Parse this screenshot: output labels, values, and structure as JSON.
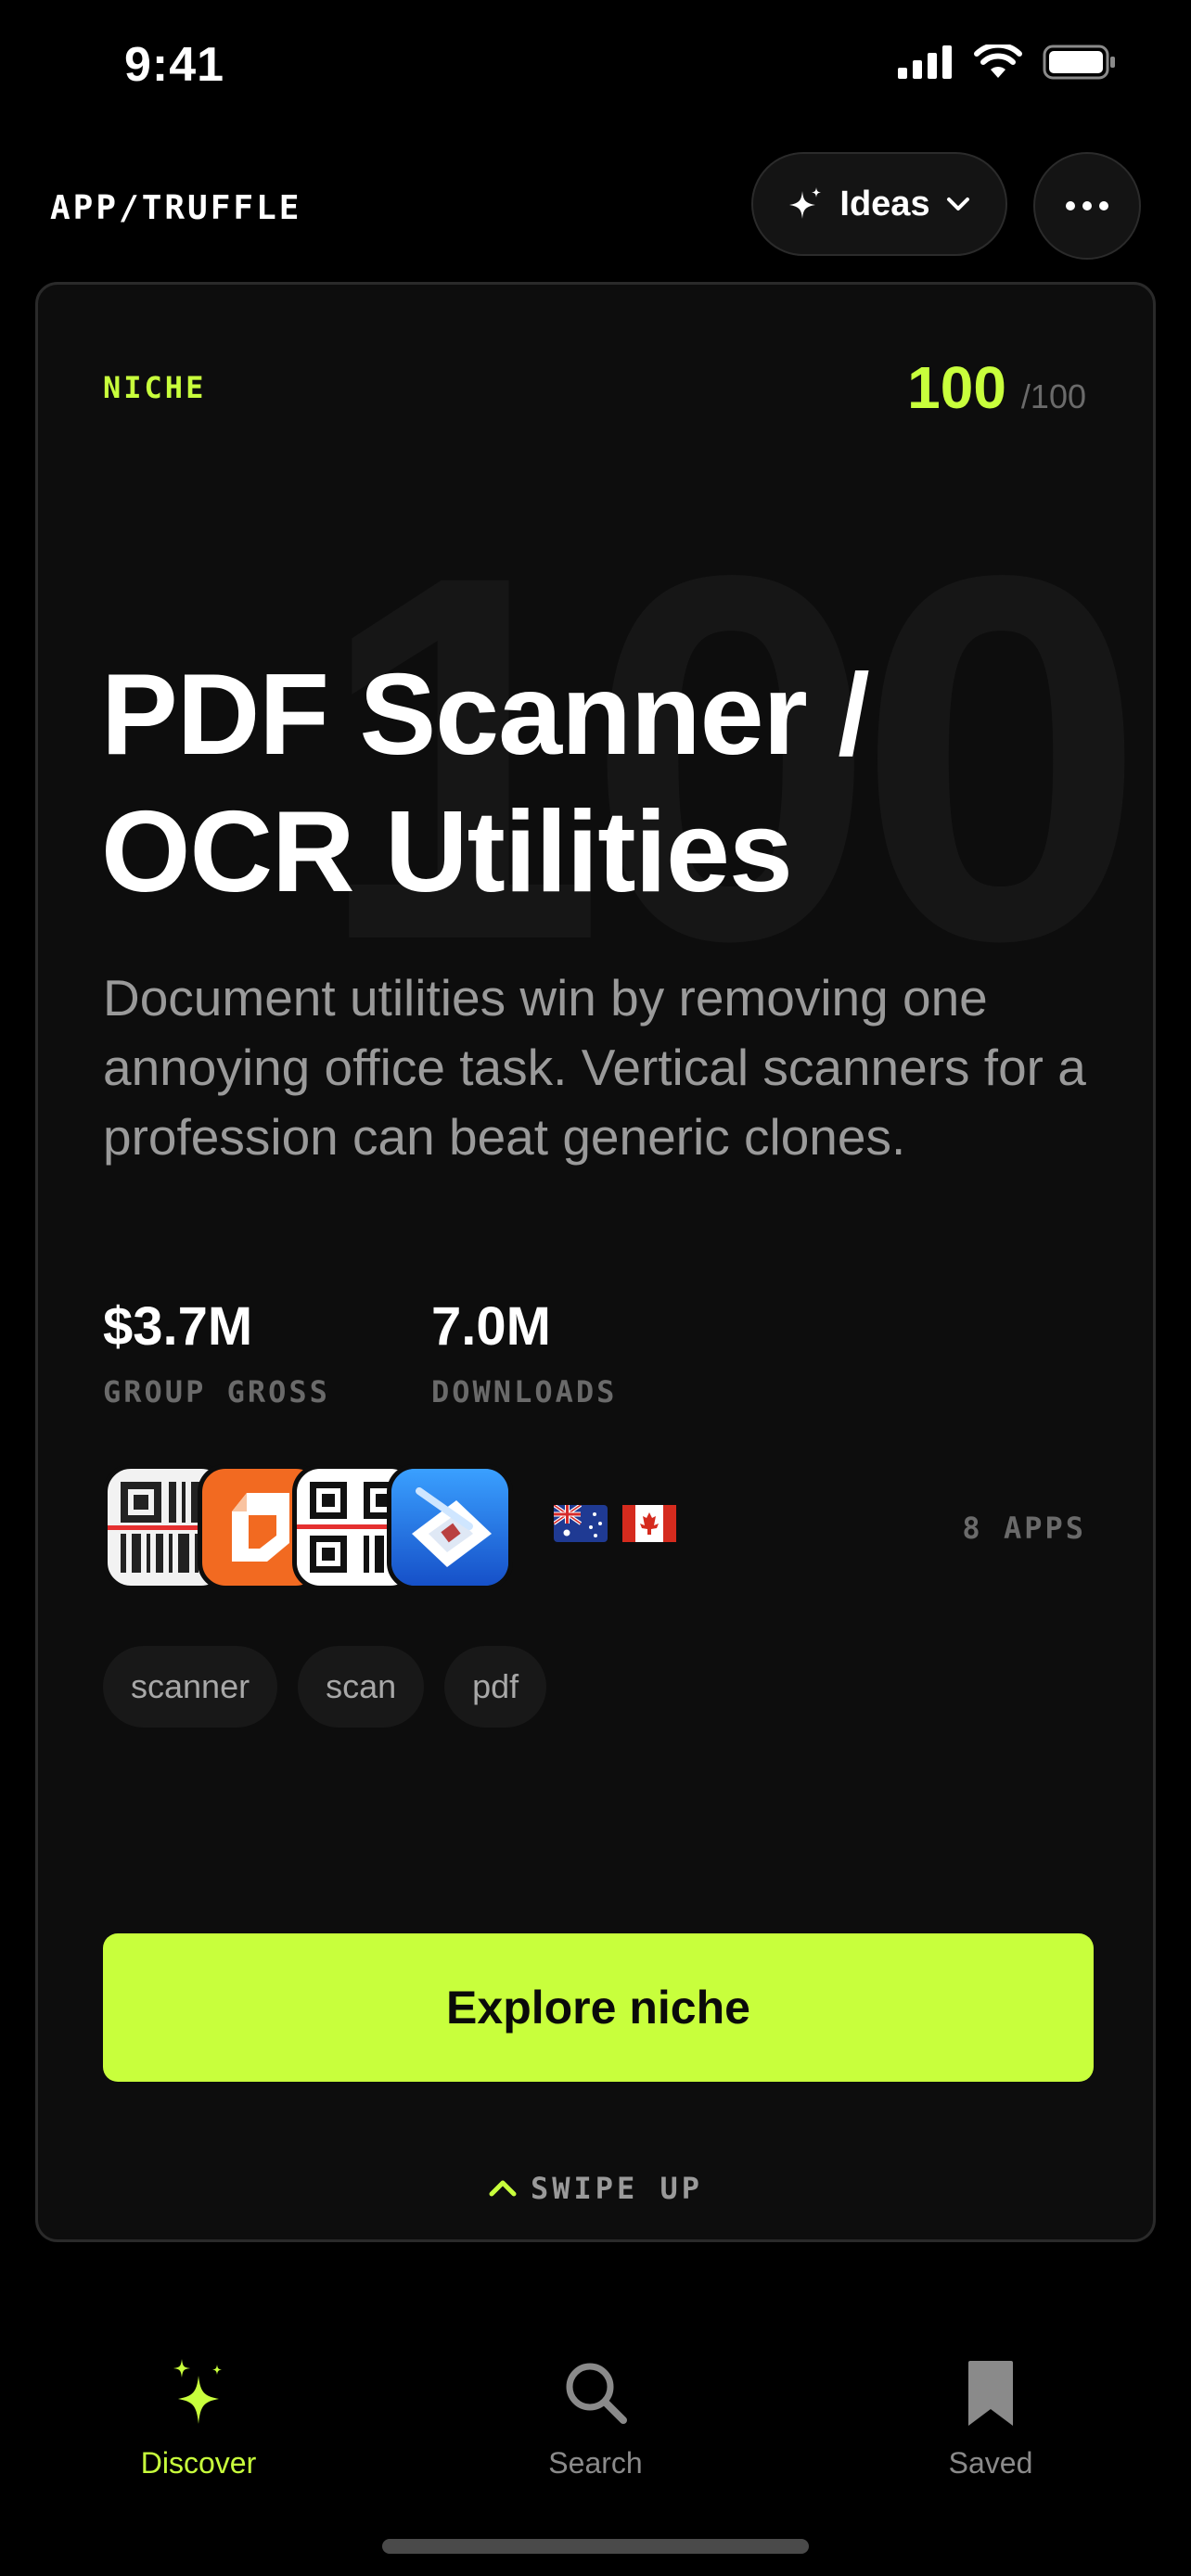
{
  "status_bar": {
    "time": "9:41"
  },
  "header": {
    "brand": "APP/TRUFFLE",
    "ideas_label": "Ideas"
  },
  "card": {
    "niche_label": "NICHE",
    "score": "100",
    "score_max": "/100",
    "watermark": "100",
    "title_line1": "PDF Scanner /",
    "title_line2": "OCR Utilities",
    "description": "Document utilities win by removing one annoying office task. Vertical scanners for a profession can beat generic clones.",
    "stats": [
      {
        "value": "$3.7M",
        "label": "GROUP GROSS"
      },
      {
        "value": "7.0M",
        "label": "DOWNLOADS"
      }
    ],
    "apps_count": "8 APPS",
    "countries": [
      "Australia",
      "Canada"
    ],
    "tags": [
      "scanner",
      "scan",
      "pdf"
    ],
    "cta_label": "Explore niche",
    "swipe_label": "SWIPE UP"
  },
  "tabbar": {
    "tabs": [
      {
        "label": "Discover",
        "active": true
      },
      {
        "label": "Search",
        "active": false
      },
      {
        "label": "Saved",
        "active": false
      }
    ]
  },
  "colors": {
    "accent": "#c8ff3c",
    "background": "#000000",
    "card": "#0d0d0d",
    "muted": "#6a6a6a"
  }
}
